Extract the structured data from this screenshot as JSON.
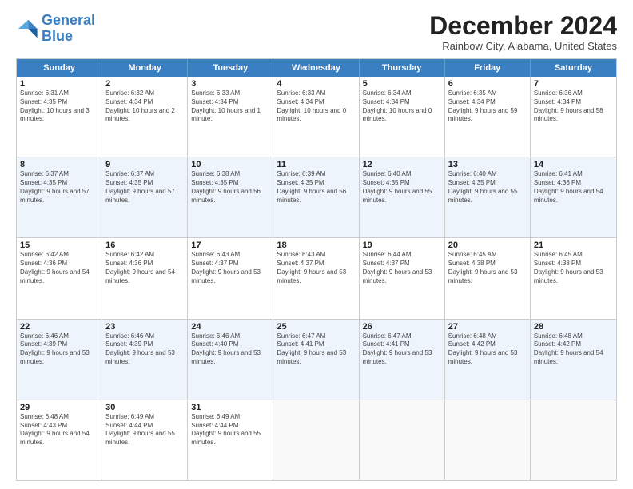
{
  "logo": {
    "line1": "General",
    "line2": "Blue"
  },
  "title": "December 2024",
  "subtitle": "Rainbow City, Alabama, United States",
  "headers": [
    "Sunday",
    "Monday",
    "Tuesday",
    "Wednesday",
    "Thursday",
    "Friday",
    "Saturday"
  ],
  "weeks": [
    [
      {
        "day": "1",
        "rise": "6:31 AM",
        "set": "4:35 PM",
        "daylight": "10 hours and 3 minutes."
      },
      {
        "day": "2",
        "rise": "6:32 AM",
        "set": "4:34 PM",
        "daylight": "10 hours and 2 minutes."
      },
      {
        "day": "3",
        "rise": "6:33 AM",
        "set": "4:34 PM",
        "daylight": "10 hours and 1 minute."
      },
      {
        "day": "4",
        "rise": "6:33 AM",
        "set": "4:34 PM",
        "daylight": "10 hours and 0 minutes."
      },
      {
        "day": "5",
        "rise": "6:34 AM",
        "set": "4:34 PM",
        "daylight": "10 hours and 0 minutes."
      },
      {
        "day": "6",
        "rise": "6:35 AM",
        "set": "4:34 PM",
        "daylight": "9 hours and 59 minutes."
      },
      {
        "day": "7",
        "rise": "6:36 AM",
        "set": "4:34 PM",
        "daylight": "9 hours and 58 minutes."
      }
    ],
    [
      {
        "day": "8",
        "rise": "6:37 AM",
        "set": "4:35 PM",
        "daylight": "9 hours and 57 minutes."
      },
      {
        "day": "9",
        "rise": "6:37 AM",
        "set": "4:35 PM",
        "daylight": "9 hours and 57 minutes."
      },
      {
        "day": "10",
        "rise": "6:38 AM",
        "set": "4:35 PM",
        "daylight": "9 hours and 56 minutes."
      },
      {
        "day": "11",
        "rise": "6:39 AM",
        "set": "4:35 PM",
        "daylight": "9 hours and 56 minutes."
      },
      {
        "day": "12",
        "rise": "6:40 AM",
        "set": "4:35 PM",
        "daylight": "9 hours and 55 minutes."
      },
      {
        "day": "13",
        "rise": "6:40 AM",
        "set": "4:35 PM",
        "daylight": "9 hours and 55 minutes."
      },
      {
        "day": "14",
        "rise": "6:41 AM",
        "set": "4:36 PM",
        "daylight": "9 hours and 54 minutes."
      }
    ],
    [
      {
        "day": "15",
        "rise": "6:42 AM",
        "set": "4:36 PM",
        "daylight": "9 hours and 54 minutes."
      },
      {
        "day": "16",
        "rise": "6:42 AM",
        "set": "4:36 PM",
        "daylight": "9 hours and 54 minutes."
      },
      {
        "day": "17",
        "rise": "6:43 AM",
        "set": "4:37 PM",
        "daylight": "9 hours and 53 minutes."
      },
      {
        "day": "18",
        "rise": "6:43 AM",
        "set": "4:37 PM",
        "daylight": "9 hours and 53 minutes."
      },
      {
        "day": "19",
        "rise": "6:44 AM",
        "set": "4:37 PM",
        "daylight": "9 hours and 53 minutes."
      },
      {
        "day": "20",
        "rise": "6:45 AM",
        "set": "4:38 PM",
        "daylight": "9 hours and 53 minutes."
      },
      {
        "day": "21",
        "rise": "6:45 AM",
        "set": "4:38 PM",
        "daylight": "9 hours and 53 minutes."
      }
    ],
    [
      {
        "day": "22",
        "rise": "6:46 AM",
        "set": "4:39 PM",
        "daylight": "9 hours and 53 minutes."
      },
      {
        "day": "23",
        "rise": "6:46 AM",
        "set": "4:39 PM",
        "daylight": "9 hours and 53 minutes."
      },
      {
        "day": "24",
        "rise": "6:46 AM",
        "set": "4:40 PM",
        "daylight": "9 hours and 53 minutes."
      },
      {
        "day": "25",
        "rise": "6:47 AM",
        "set": "4:41 PM",
        "daylight": "9 hours and 53 minutes."
      },
      {
        "day": "26",
        "rise": "6:47 AM",
        "set": "4:41 PM",
        "daylight": "9 hours and 53 minutes."
      },
      {
        "day": "27",
        "rise": "6:48 AM",
        "set": "4:42 PM",
        "daylight": "9 hours and 53 minutes."
      },
      {
        "day": "28",
        "rise": "6:48 AM",
        "set": "4:42 PM",
        "daylight": "9 hours and 54 minutes."
      }
    ],
    [
      {
        "day": "29",
        "rise": "6:48 AM",
        "set": "4:43 PM",
        "daylight": "9 hours and 54 minutes."
      },
      {
        "day": "30",
        "rise": "6:49 AM",
        "set": "4:44 PM",
        "daylight": "9 hours and 55 minutes."
      },
      {
        "day": "31",
        "rise": "6:49 AM",
        "set": "4:44 PM",
        "daylight": "9 hours and 55 minutes."
      },
      null,
      null,
      null,
      null
    ]
  ]
}
